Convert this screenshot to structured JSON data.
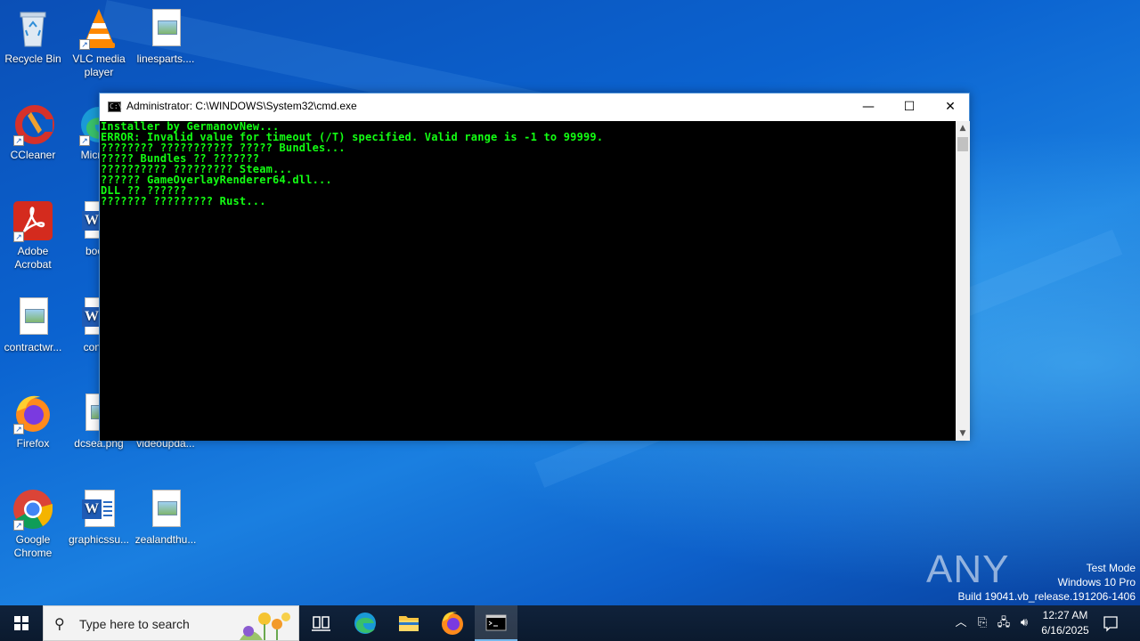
{
  "desktop_icons": [
    {
      "label": "Recycle Bin"
    },
    {
      "label": "VLC media player"
    },
    {
      "label": "linesparts...."
    },
    {
      "label": "CCleaner"
    },
    {
      "label": "Micr Ed"
    },
    {
      "label": "Adobe Acrobat"
    },
    {
      "label": "bookr"
    },
    {
      "label": "contractwr..."
    },
    {
      "label": "consid"
    },
    {
      "label": "Firefox"
    },
    {
      "label": "dcsea.png"
    },
    {
      "label": "videoupda..."
    },
    {
      "label": "Google Chrome"
    },
    {
      "label": "graphicssu..."
    },
    {
      "label": "zealandthu..."
    }
  ],
  "cmd_window": {
    "title": "Administrator: C:\\WINDOWS\\System32\\cmd.exe",
    "minimize_glyph": "—",
    "maximize_glyph": "☐",
    "close_glyph": "✕",
    "console_color": "#13ff13",
    "lines": [
      "Installer by GermanovNew...",
      "ERROR: Invalid value for timeout (/T) specified. Valid range is -1 to 99999.",
      "???????? ??????????? ????? Bundles...",
      "????? Bundles ?? ???????",
      "?????????? ????????? Steam...",
      "?????? GameOverlayRenderer64.dll...",
      "DLL ?? ??????",
      "??????? ????????? Rust..."
    ]
  },
  "watermark": {
    "logo": "ANY RUN",
    "line1": "Test Mode",
    "line2": "Windows 10 Pro",
    "line3": "Build 19041.vb_release.191206-1406"
  },
  "taskbar": {
    "search_placeholder": "Type here to search",
    "time": "12:27 AM",
    "date": "6/16/2025",
    "pinned": [
      "task-view",
      "edge",
      "file-explorer",
      "firefox",
      "cmd"
    ]
  }
}
